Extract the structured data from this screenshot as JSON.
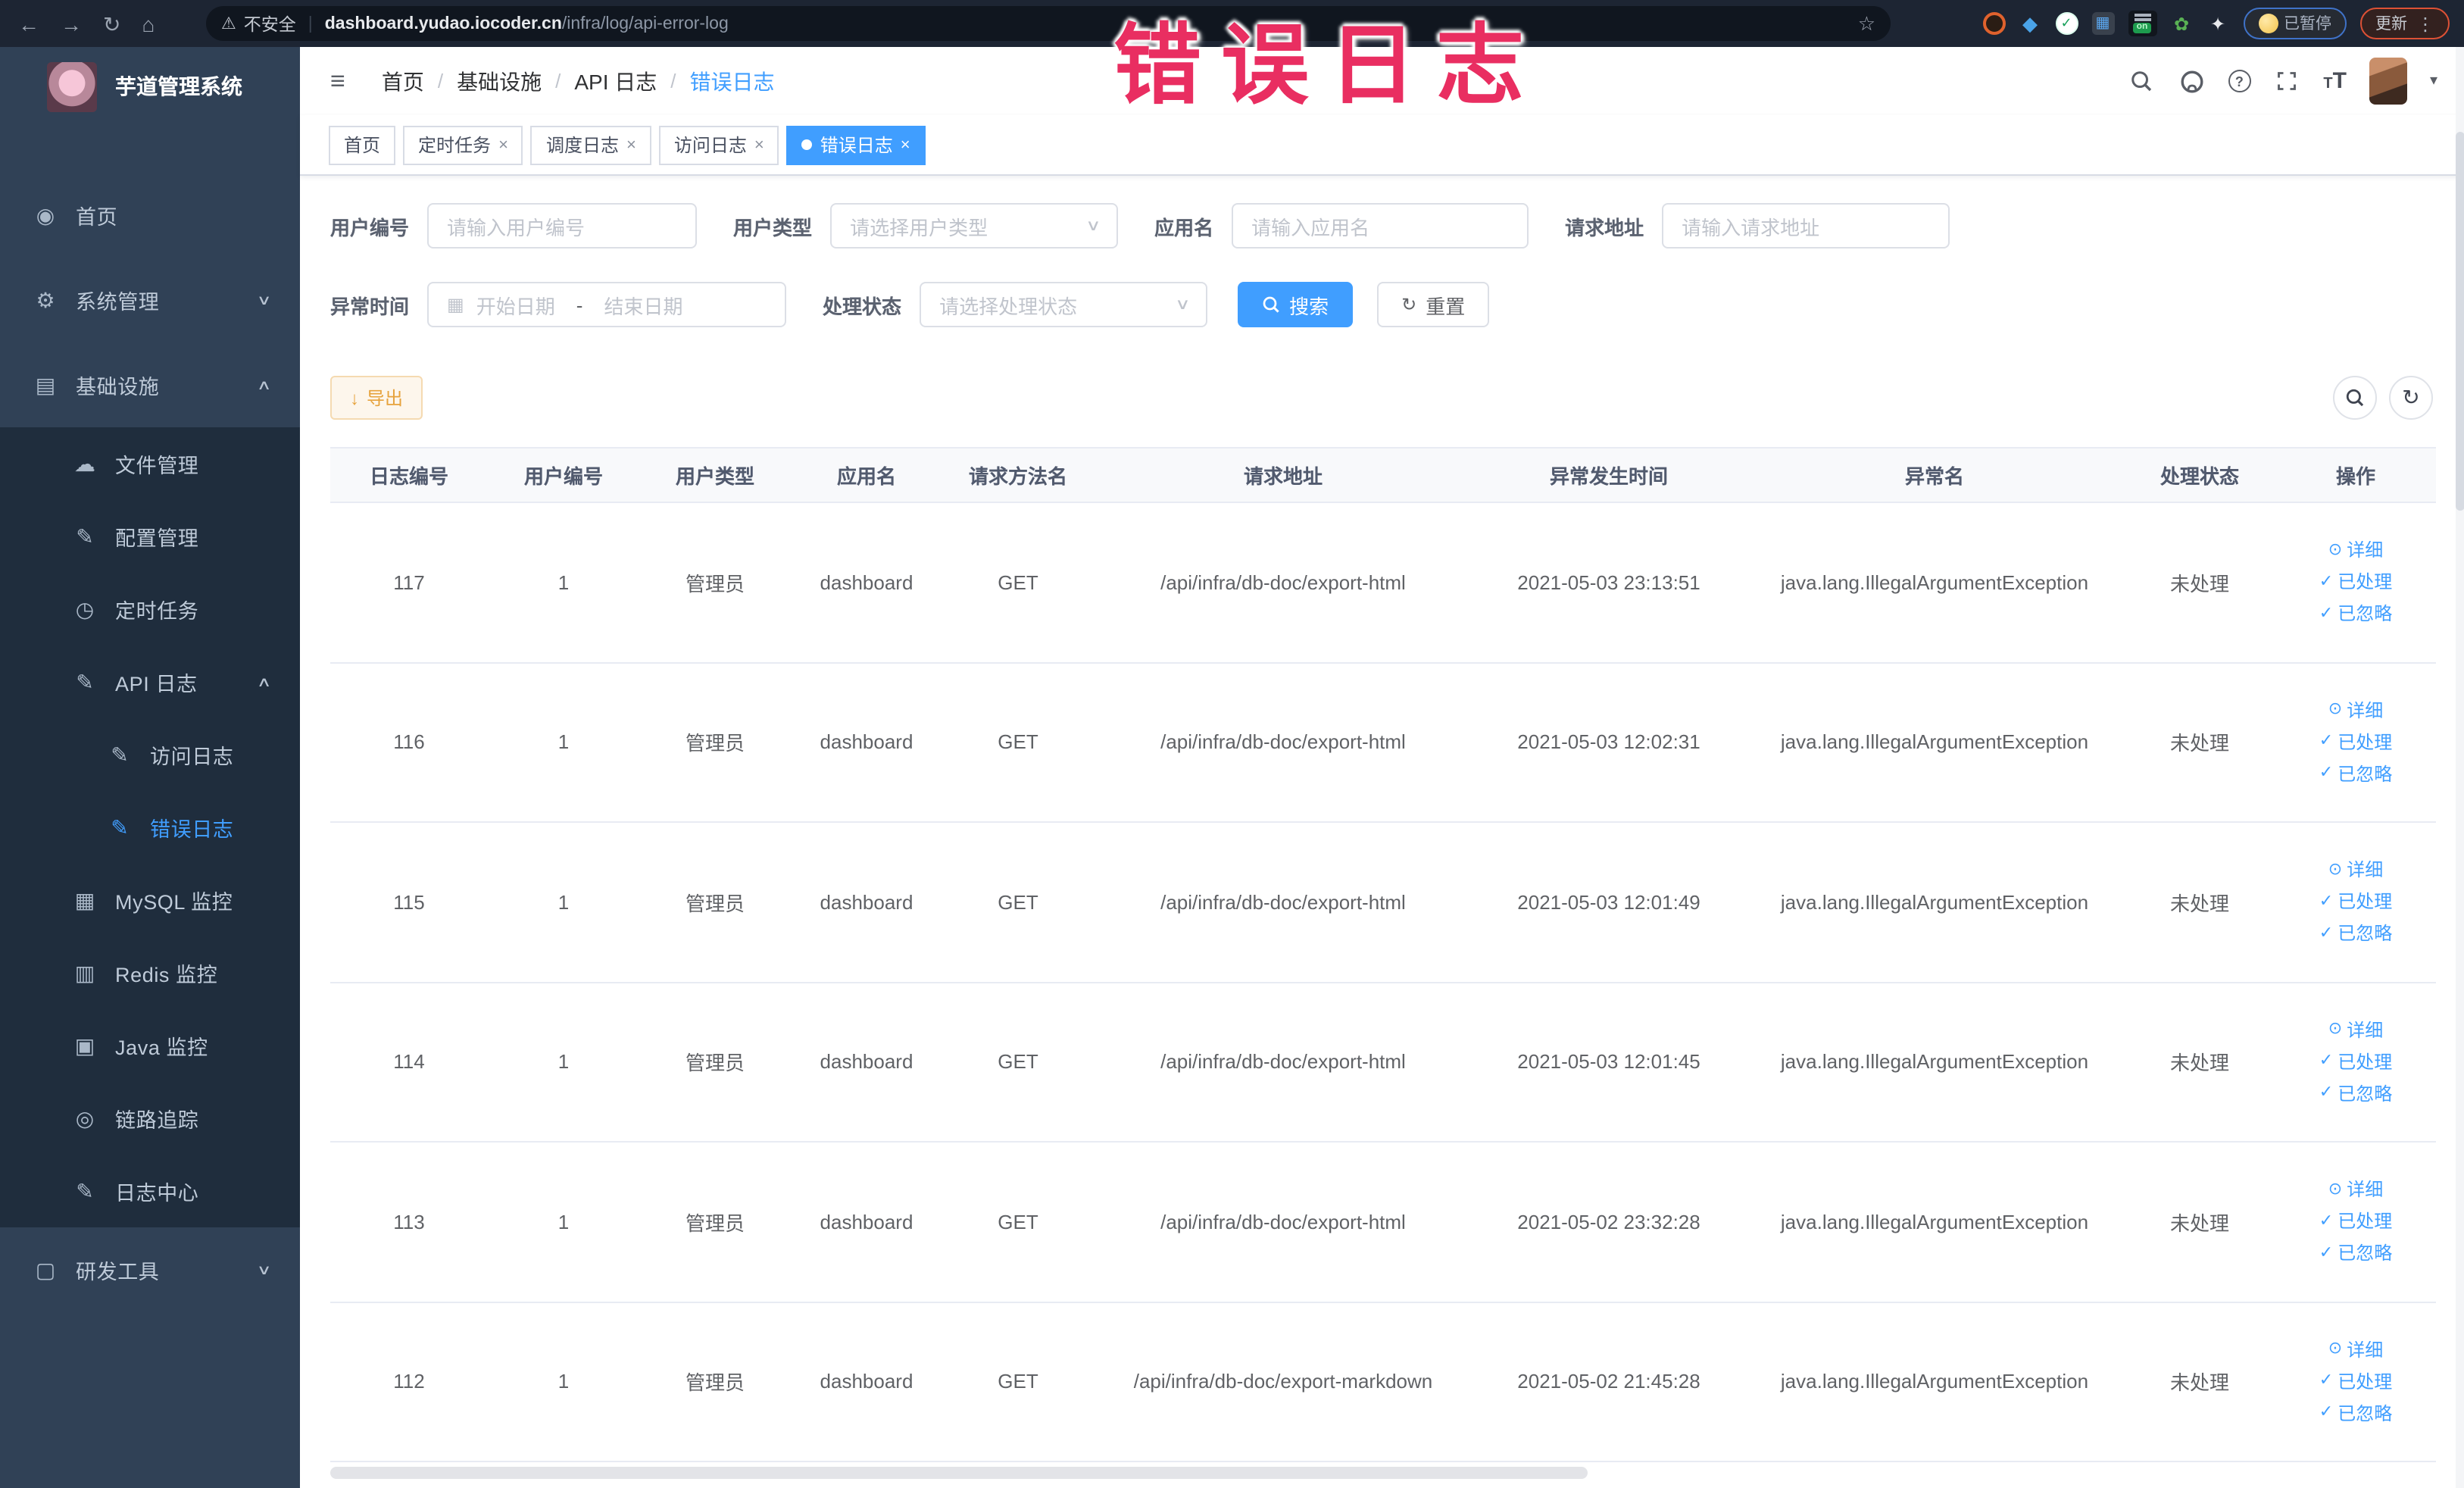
{
  "browser": {
    "security_label": "不安全",
    "url_host": "dashboard.yudao.iocoder.cn",
    "url_path": "/infra/log/api-error-log",
    "on_badge": "on",
    "paused_badge": "已暂停",
    "update_badge": "更新"
  },
  "annotation": {
    "text": "错误日志"
  },
  "sidebar": {
    "title": "芋道管理系统",
    "items": [
      {
        "id": "home",
        "label": "首页",
        "icon": "users",
        "level": "top"
      },
      {
        "id": "system-management",
        "label": "系统管理",
        "icon": "gear",
        "level": "top",
        "arrow": "down"
      },
      {
        "id": "infrastructure",
        "label": "基础设施",
        "icon": "monitor",
        "level": "top",
        "arrow": "up"
      },
      {
        "id": "file-management",
        "label": "文件管理",
        "icon": "cloud",
        "level": "sub"
      },
      {
        "id": "config-management",
        "label": "配置管理",
        "icon": "edit",
        "level": "sub"
      },
      {
        "id": "scheduled-tasks",
        "label": "定时任务",
        "icon": "timer",
        "level": "sub"
      },
      {
        "id": "api-log",
        "label": "API 日志",
        "icon": "edit",
        "level": "sub",
        "arrow": "up"
      },
      {
        "id": "access-log",
        "label": "访问日志",
        "icon": "edit",
        "level": "sub2"
      },
      {
        "id": "error-log",
        "label": "错误日志",
        "icon": "edit",
        "level": "sub2",
        "active": true
      },
      {
        "id": "mysql-monitor",
        "label": "MySQL 监控",
        "icon": "chart",
        "level": "sub"
      },
      {
        "id": "redis-monitor",
        "label": "Redis 监控",
        "icon": "stack",
        "level": "sub"
      },
      {
        "id": "java-monitor",
        "label": "Java 监控",
        "icon": "desktop",
        "level": "sub"
      },
      {
        "id": "link-tracing",
        "label": "链路追踪",
        "icon": "eye_outline",
        "level": "sub"
      },
      {
        "id": "log-center",
        "label": "日志中心",
        "icon": "edit",
        "level": "sub"
      },
      {
        "id": "dev-tools",
        "label": "研发工具",
        "icon": "briefcase",
        "level": "top",
        "arrow": "down"
      }
    ]
  },
  "navbar": {
    "breadcrumb": [
      "首页",
      "基础设施",
      "API 日志",
      "错误日志"
    ]
  },
  "tabs": [
    {
      "id": "home",
      "label": "首页",
      "closable": false,
      "active": false
    },
    {
      "id": "scheduled-tasks",
      "label": "定时任务",
      "closable": true,
      "active": false
    },
    {
      "id": "job-log",
      "label": "调度日志",
      "closable": true,
      "active": false
    },
    {
      "id": "access-log",
      "label": "访问日志",
      "closable": true,
      "active": false
    },
    {
      "id": "error-log",
      "label": "错误日志",
      "closable": true,
      "active": true
    }
  ],
  "filters": {
    "user_id": {
      "label": "用户编号",
      "placeholder": "请输入用户编号"
    },
    "user_type": {
      "label": "用户类型",
      "placeholder": "请选择用户类型"
    },
    "app_name": {
      "label": "应用名",
      "placeholder": "请输入应用名"
    },
    "request_url": {
      "label": "请求地址",
      "placeholder": "请输入请求地址"
    },
    "exception_time": {
      "label": "异常时间",
      "start_placeholder": "开始日期",
      "separator": "-",
      "end_placeholder": "结束日期"
    },
    "process_status": {
      "label": "处理状态",
      "placeholder": "请选择处理状态"
    },
    "search_label": "搜索",
    "reset_label": "重置"
  },
  "toolbar": {
    "export_label": "导出"
  },
  "table": {
    "columns": [
      "日志编号",
      "用户编号",
      "用户类型",
      "应用名",
      "请求方法名",
      "请求地址",
      "异常发生时间",
      "异常名",
      "处理状态",
      "操作"
    ],
    "row_actions": [
      "详细",
      "已处理",
      "已忽略"
    ],
    "rows": [
      {
        "id": "117",
        "user_id": "1",
        "user_type": "管理员",
        "app": "dashboard",
        "method": "GET",
        "url": "/api/infra/db-doc/export-html",
        "time": "2021-05-03 23:13:51",
        "exception": "java.lang.IllegalArgumentException",
        "status": "未处理"
      },
      {
        "id": "116",
        "user_id": "1",
        "user_type": "管理员",
        "app": "dashboard",
        "method": "GET",
        "url": "/api/infra/db-doc/export-html",
        "time": "2021-05-03 12:02:31",
        "exception": "java.lang.IllegalArgumentException",
        "status": "未处理"
      },
      {
        "id": "115",
        "user_id": "1",
        "user_type": "管理员",
        "app": "dashboard",
        "method": "GET",
        "url": "/api/infra/db-doc/export-html",
        "time": "2021-05-03 12:01:49",
        "exception": "java.lang.IllegalArgumentException",
        "status": "未处理"
      },
      {
        "id": "114",
        "user_id": "1",
        "user_type": "管理员",
        "app": "dashboard",
        "method": "GET",
        "url": "/api/infra/db-doc/export-html",
        "time": "2021-05-03 12:01:45",
        "exception": "java.lang.IllegalArgumentException",
        "status": "未处理"
      },
      {
        "id": "113",
        "user_id": "1",
        "user_type": "管理员",
        "app": "dashboard",
        "method": "GET",
        "url": "/api/infra/db-doc/export-html",
        "time": "2021-05-02 23:32:28",
        "exception": "java.lang.IllegalArgumentException",
        "status": "未处理"
      },
      {
        "id": "112",
        "user_id": "1",
        "user_type": "管理员",
        "app": "dashboard",
        "method": "GET",
        "url": "/api/infra/db-doc/export-markdown",
        "time": "2021-05-02 21:45:28",
        "exception": "java.lang.IllegalArgumentException",
        "status": "未处理"
      }
    ]
  },
  "accent_colors": {
    "primary": "#409eff",
    "sidebar_bg": "#304156",
    "submenu_bg": "#1f2d3d",
    "warning": "#e6a23c",
    "annotation": "#e92e61"
  },
  "icon_glyphs": {
    "back": "←",
    "forward": "→",
    "reload": "↻",
    "home": "⌂",
    "warning": "⚠",
    "star": "☆",
    "kebab": "⋮",
    "shield": "◆",
    "grid": "▦",
    "leaf": "✿",
    "puzzle": "✦",
    "greenv": "✓",
    "hamburger": "≡",
    "caret_down": "▾",
    "chevron_down": "∨",
    "chevron_up": "∧",
    "question": "?",
    "t_small": "T",
    "t_big": "T",
    "separator": "|",
    "users": "◉",
    "gear": "⚙",
    "monitor": "▤",
    "cloud": "☁",
    "edit": "✎",
    "timer": "◷",
    "chart": "▦",
    "stack": "▥",
    "desktop": "▣",
    "eye_outline": "◎",
    "briefcase": "▢",
    "calendar": "▦",
    "refresh": "↻",
    "download": "↓",
    "eye": "⊙",
    "check": "✓",
    "close": "×"
  }
}
